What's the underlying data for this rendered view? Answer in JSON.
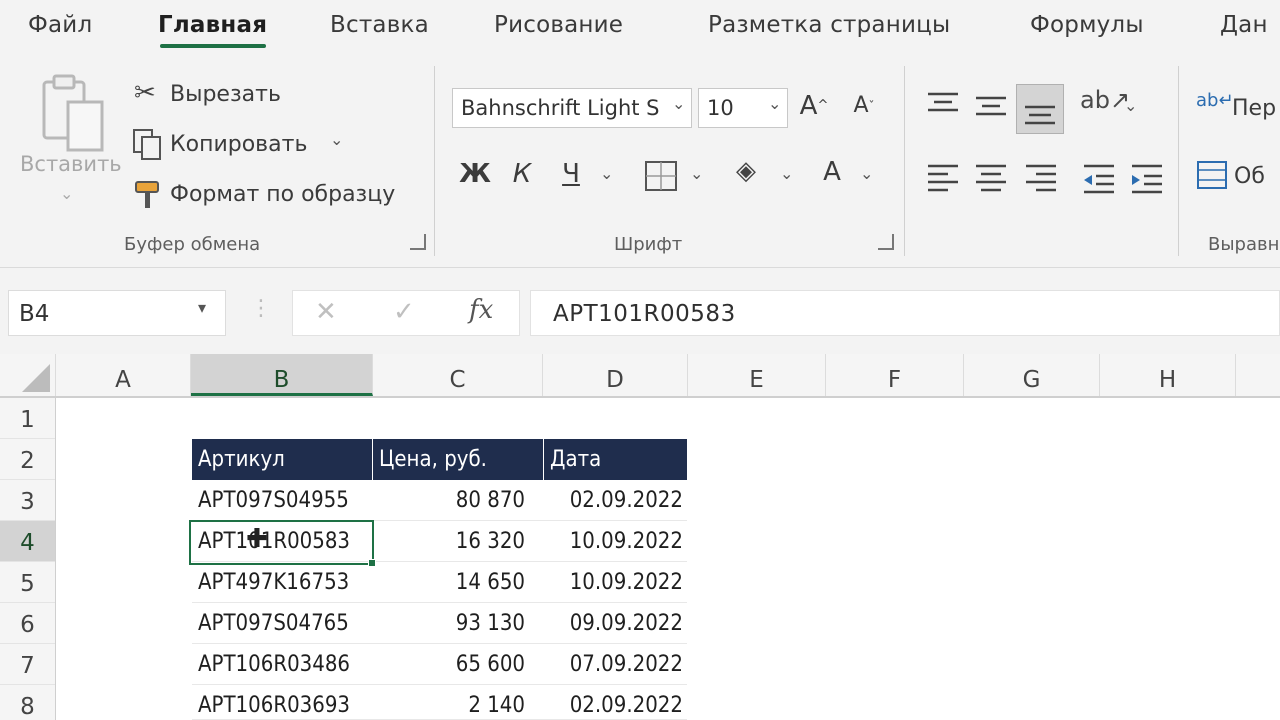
{
  "menu": {
    "tabs": [
      "Файл",
      "Главная",
      "Вставка",
      "Рисование",
      "Разметка страницы",
      "Формулы",
      "Дан"
    ],
    "active": "Главная"
  },
  "ribbon": {
    "clipboard": {
      "paste": "Вставить",
      "cut": "Вырезать",
      "copy": "Копировать",
      "format_painter": "Формат по образцу",
      "group": "Буфер обмена"
    },
    "font": {
      "name": "Bahnschrift Light S",
      "size": "10",
      "bold": "Ж",
      "italic": "К",
      "underline": "Ч",
      "color_letter": "А",
      "group": "Шрифт"
    },
    "alignment": {
      "wrap": "Пер",
      "merge": "Об",
      "group": "Выравн"
    }
  },
  "formula_bar": {
    "name_box": "B4",
    "fx": "fx",
    "value": "APT101R00583"
  },
  "columns": [
    "A",
    "B",
    "C",
    "D",
    "E",
    "F",
    "G",
    "H"
  ],
  "selected_column": "B",
  "rows": [
    "1",
    "2",
    "3",
    "4",
    "5",
    "6",
    "7",
    "8"
  ],
  "selected_row": "4",
  "table": {
    "headers": [
      "Артикул",
      "Цена, руб.",
      "Дата"
    ],
    "rows": [
      [
        "APT097S04955",
        "80 870",
        "02.09.2022"
      ],
      [
        "APT101R00583",
        "16 320",
        "10.09.2022"
      ],
      [
        "APT497K16753",
        "14 650",
        "10.09.2022"
      ],
      [
        "APT097S04765",
        "93 130",
        "09.09.2022"
      ],
      [
        "APT106R03486",
        "65 600",
        "07.09.2022"
      ],
      [
        "APT106R03693",
        "2 140",
        "02.09.2022"
      ]
    ]
  },
  "colors": {
    "accent": "#1e7145",
    "table_header": "#1f2d4d"
  }
}
